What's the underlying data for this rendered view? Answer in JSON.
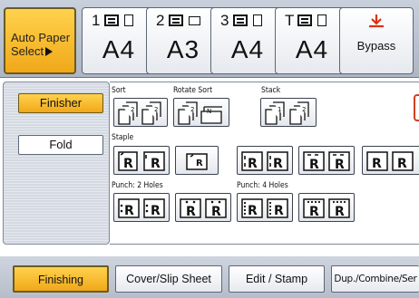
{
  "top": {
    "auto_paper_line1": "Auto Paper",
    "auto_paper_line2": "Select",
    "trays": [
      {
        "num": "1",
        "size": "A4"
      },
      {
        "num": "2",
        "size": "A3"
      },
      {
        "num": "3",
        "size": "A4"
      },
      {
        "num": "T",
        "size": "A4"
      }
    ],
    "bypass_label": "Bypass",
    "bypass_icon": "bypass-arrow-icon",
    "accent": "#f0a818",
    "arrow_color": "#e03010"
  },
  "side": {
    "finisher_label": "Finisher",
    "fold_label": "Fold"
  },
  "content": {
    "sort_label": "Sort",
    "rotate_sort_label": "Rotate Sort",
    "stack_label": "Stack",
    "staple_label": "Staple",
    "punch2_label": "Punch: 2 Holes",
    "punch4_label": "Punch: 4 Holes"
  },
  "tabs": {
    "finishing": "Finishing",
    "cover_slip": "Cover/Slip Sheet",
    "edit_stamp": "Edit / Stamp",
    "dup_combine": "Dup./Combine/Ser"
  }
}
